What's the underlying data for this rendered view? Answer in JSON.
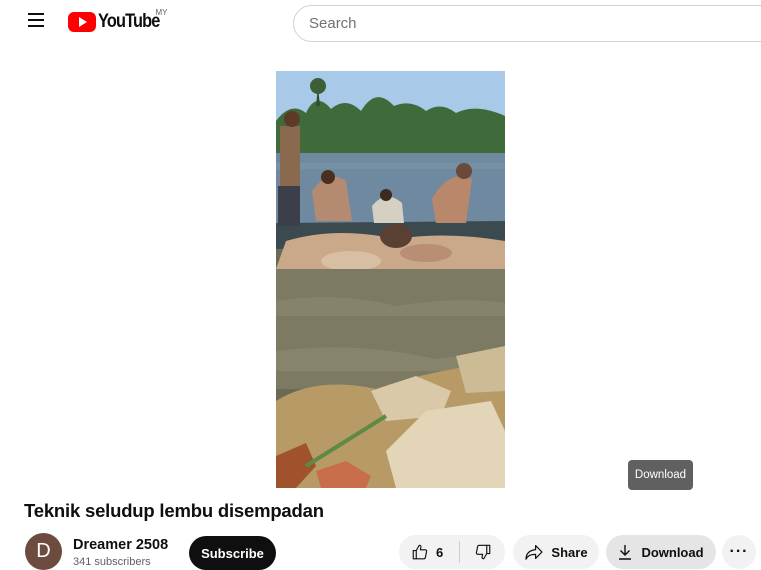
{
  "header": {
    "logo_text": "YouTube",
    "country_code": "MY",
    "search_placeholder": "Search"
  },
  "video": {
    "title": "Teknik seludup lembu disempadan",
    "tooltip": "Download"
  },
  "channel": {
    "avatar_letter": "D",
    "name": "Dreamer 2508",
    "subscribers": "341 subscribers",
    "subscribe_label": "Subscribe"
  },
  "actions": {
    "like_count": "6",
    "share_label": "Share",
    "download_label": "Download",
    "more_label": "···"
  },
  "colors": {
    "brand_red": "#ff0000",
    "subscribe_bg": "#0f0f0f",
    "pill_bg": "#f2f2f2",
    "avatar_bg": "#6d4b3e"
  }
}
